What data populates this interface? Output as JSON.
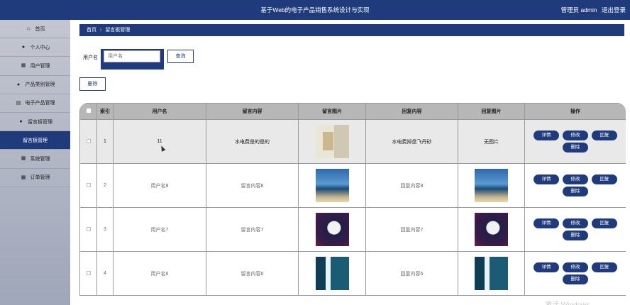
{
  "header": {
    "title": "基于Web的电子产品销售系统设计与实现",
    "user_label": "管理员 admin",
    "logout_label": "退出登录"
  },
  "sidebar": {
    "items": [
      {
        "label": "首页",
        "icon": "home-icon"
      },
      {
        "label": "个人中心",
        "icon": "user-icon"
      },
      {
        "label": "用户管理",
        "icon": "grid-icon"
      },
      {
        "label": "产品类别管理",
        "icon": "user-icon"
      },
      {
        "label": "电子产品管理",
        "icon": "clipboard-icon"
      },
      {
        "label": "留言板管理",
        "icon": "user-icon"
      },
      {
        "label": "留言板管理",
        "icon": "none",
        "active": true
      },
      {
        "label": "系统管理",
        "icon": "grid-icon"
      },
      {
        "label": "订单管理",
        "icon": "grid-icon"
      }
    ]
  },
  "breadcrumb": {
    "home": "首页",
    "separator": "⁝",
    "current": "留言板管理"
  },
  "search": {
    "label": "用户名",
    "placeholder": "用户名",
    "query_label": "查询"
  },
  "toolbar": {
    "delete_label": "删除"
  },
  "table": {
    "headers": [
      "",
      "索引",
      "用户名",
      "留言内容",
      "留言图片",
      "回复内容",
      "回复图片",
      "操作"
    ],
    "rows": [
      {
        "index": "1",
        "username": "11",
        "content": "水电费是的是的",
        "image": "book",
        "reply": "水电费掉盘飞丹砂",
        "reply_image": "无图片"
      },
      {
        "index": "2",
        "username": "用户名8",
        "content": "留言内容8",
        "image": "beach",
        "reply": "回复内容8",
        "reply_image": "beach"
      },
      {
        "index": "3",
        "username": "用户名7",
        "content": "留言内容7",
        "image": "night",
        "reply": "回复内容7",
        "reply_image": "night"
      },
      {
        "index": "4",
        "username": "用户名6",
        "content": "留言内容6",
        "image": "falls",
        "reply": "回复内容6",
        "reply_image": "falls"
      }
    ],
    "actions": [
      "详情",
      "修改",
      "回复",
      "删除"
    ]
  },
  "watermark": "激活 Windows"
}
